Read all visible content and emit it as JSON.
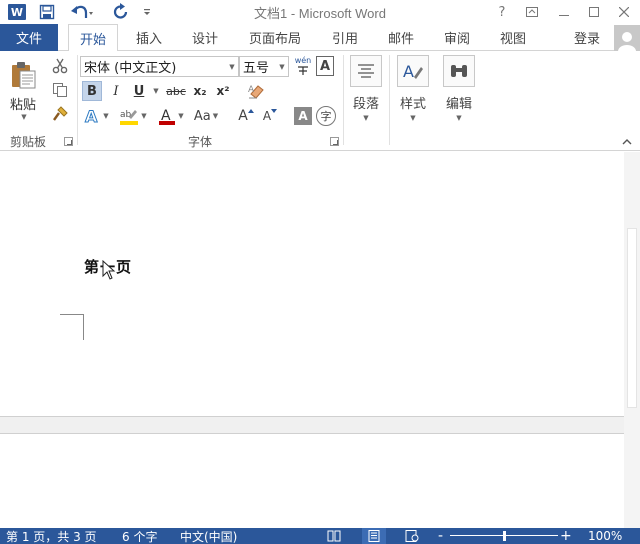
{
  "window": {
    "title": "文档1 - Microsoft Word",
    "help_label": "?"
  },
  "quick_access": {
    "logo_letter": "W"
  },
  "tabs": {
    "file": "文件",
    "items": [
      "开始",
      "插入",
      "设计",
      "页面布局",
      "引用",
      "邮件",
      "审阅",
      "视图"
    ],
    "active_index": 0,
    "sign_in": "登录"
  },
  "ribbon": {
    "clipboard": {
      "paste_label": "粘贴",
      "group_label": "剪贴板"
    },
    "font": {
      "font_name": "宋体 (中文正文)",
      "font_size": "五号",
      "pinyin_label": "wén",
      "bold": "B",
      "italic": "I",
      "underline": "U",
      "strikethrough": "abc",
      "subscript": "x₂",
      "superscript": "x²",
      "change_case": "Aa",
      "grow_font": "A",
      "shrink_font": "A",
      "enclose_char": "字",
      "group_label": "字体"
    },
    "paragraph": {
      "label": "段落"
    },
    "styles": {
      "label": "样式"
    },
    "editing": {
      "label": "编辑"
    }
  },
  "document": {
    "text": "第一页"
  },
  "status_bar": {
    "page_info": "第 1 页，共 3 页",
    "word_count": "6 个字",
    "language": "中文(中国)",
    "zoom_minus": "-",
    "zoom_plus": "+",
    "zoom_level": "100%",
    "zoom_fraction": 0.5
  },
  "colors": {
    "accent": "#2b579a",
    "highlight_yellow": "#ffd700",
    "font_red": "#c00000"
  }
}
